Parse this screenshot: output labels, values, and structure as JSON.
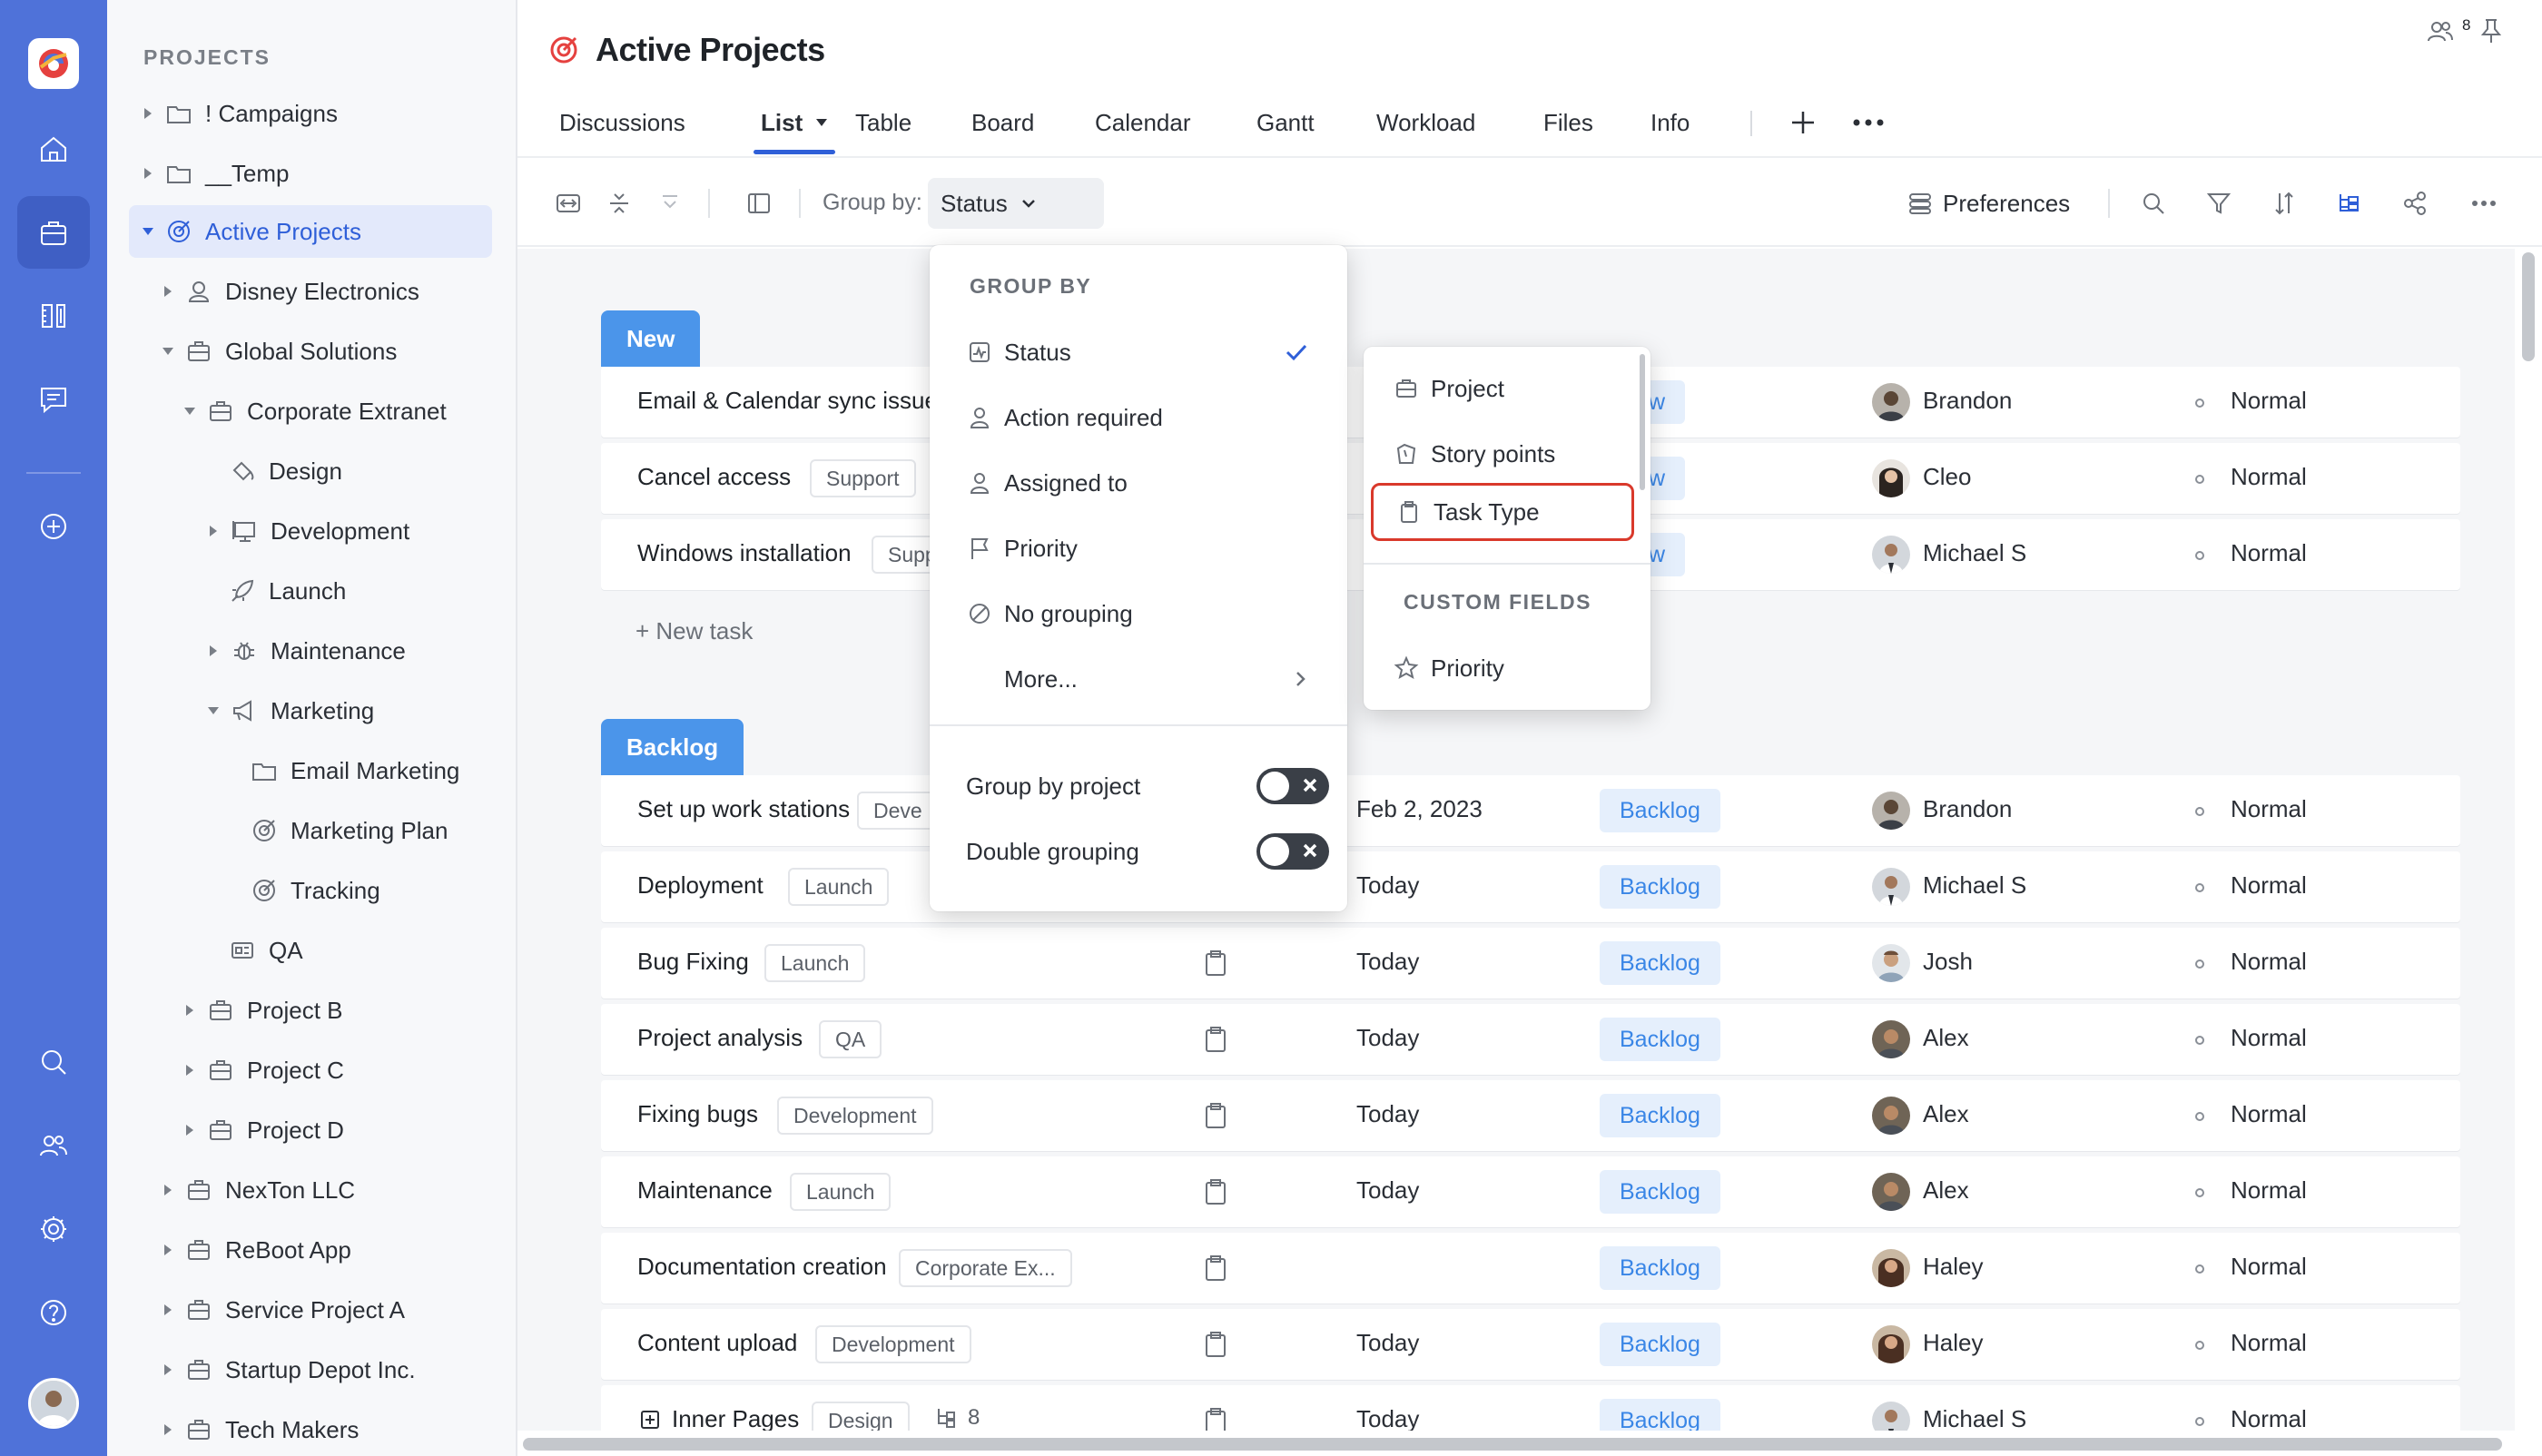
{
  "sidebar": {
    "title": "PROJECTS",
    "items": [
      {
        "label": "! Campaigns",
        "icon": "folder-icon"
      },
      {
        "label": "__Temp",
        "icon": "folder-icon"
      },
      {
        "label": "Active Projects",
        "icon": "target-icon"
      },
      {
        "label": "Disney Electronics",
        "icon": "client-icon"
      },
      {
        "label": "Global Solutions",
        "icon": "briefcase-icon"
      },
      {
        "label": "Corporate Extranet",
        "icon": "briefcase-icon"
      },
      {
        "label": "Design",
        "icon": "paint-bucket-icon"
      },
      {
        "label": "Development",
        "icon": "monitor-icon"
      },
      {
        "label": "Launch",
        "icon": "rocket-icon"
      },
      {
        "label": "Maintenance",
        "icon": "bug-icon"
      },
      {
        "label": "Marketing",
        "icon": "megaphone-icon"
      },
      {
        "label": "Email Marketing",
        "icon": "folder-icon"
      },
      {
        "label": "Marketing Plan",
        "icon": "target-icon"
      },
      {
        "label": "Tracking",
        "icon": "target-icon"
      },
      {
        "label": "QA",
        "icon": "qa-icon"
      },
      {
        "label": "Project B",
        "icon": "briefcase-icon"
      },
      {
        "label": "Project C",
        "icon": "briefcase-icon"
      },
      {
        "label": "Project D",
        "icon": "briefcase-icon"
      },
      {
        "label": "NexTon LLC",
        "icon": "briefcase-icon"
      },
      {
        "label": "ReBoot App",
        "icon": "briefcase-icon"
      },
      {
        "label": "Service Project A",
        "icon": "briefcase-icon"
      },
      {
        "label": "Startup Depot Inc.",
        "icon": "briefcase-icon"
      },
      {
        "label": "Tech Makers",
        "icon": "briefcase-icon"
      }
    ]
  },
  "header": {
    "title": "Active Projects",
    "members_count": "8"
  },
  "tabs": [
    "Discussions",
    "List",
    "Table",
    "Board",
    "Calendar",
    "Gantt",
    "Workload",
    "Files",
    "Info"
  ],
  "toolbar": {
    "group_by_label": "Group by:",
    "group_by_value": "Status",
    "preferences_label": "Preferences"
  },
  "groups": [
    {
      "name": "New"
    },
    {
      "name": "Backlog"
    }
  ],
  "new_task_label": "+ New task",
  "rows": [
    {
      "name": "Email & Calendar sync issue",
      "tag": "",
      "date": "",
      "status": "New",
      "person": "Brandon",
      "priority": "Normal"
    },
    {
      "name": "Cancel access",
      "tag": "Support",
      "date": "",
      "status": "New",
      "person": "Cleo",
      "priority": "Normal"
    },
    {
      "name": "Windows installation",
      "tag": "Supp",
      "date": "",
      "status": "New",
      "person": "Michael S",
      "priority": "Normal"
    },
    {
      "name": "Set up work stations",
      "tag": "Deve",
      "date": "Feb 2, 2023",
      "status": "Backlog",
      "person": "Brandon",
      "priority": "Normal"
    },
    {
      "name": "Deployment",
      "tag": "Launch",
      "date": "Today",
      "status": "Backlog",
      "person": "Michael S",
      "priority": "Normal"
    },
    {
      "name": "Bug Fixing",
      "tag": "Launch",
      "date": "Today",
      "status": "Backlog",
      "person": "Josh",
      "priority": "Normal"
    },
    {
      "name": "Project analysis",
      "tag": "QA",
      "date": "Today",
      "status": "Backlog",
      "person": "Alex",
      "priority": "Normal"
    },
    {
      "name": "Fixing bugs",
      "tag": "Development",
      "date": "Today",
      "status": "Backlog",
      "person": "Alex",
      "priority": "Normal"
    },
    {
      "name": "Maintenance",
      "tag": "Launch",
      "date": "Today",
      "status": "Backlog",
      "person": "Alex",
      "priority": "Normal"
    },
    {
      "name": "Documentation creation",
      "tag": "Corporate Ex...",
      "date": "",
      "status": "Backlog",
      "person": "Haley",
      "priority": "Normal"
    },
    {
      "name": "Content upload",
      "tag": "Development",
      "date": "Today",
      "status": "Backlog",
      "person": "Haley",
      "priority": "Normal"
    },
    {
      "name": "Inner Pages",
      "tag": "Design",
      "children": "8",
      "date": "Today",
      "status": "Backlog",
      "person": "Michael S",
      "priority": "Normal"
    }
  ],
  "group_by_menu": {
    "heading": "GROUP BY",
    "items": [
      "Status",
      "Action required",
      "Assigned to",
      "Priority",
      "No grouping",
      "More..."
    ],
    "toggles": [
      "Group by project",
      "Double grouping"
    ]
  },
  "submenu": {
    "items": [
      "Project",
      "Story points",
      "Task Type"
    ],
    "custom_heading": "CUSTOM FIELDS",
    "custom_items": [
      "Priority"
    ]
  },
  "colors": {
    "rail": "#4f72d9",
    "accent": "#2f5fd8",
    "group_tag": "#4b95ea",
    "status_badge_bg": "#e5effc",
    "status_badge_text": "#3a86e6",
    "highlight_border": "#d9392b"
  }
}
